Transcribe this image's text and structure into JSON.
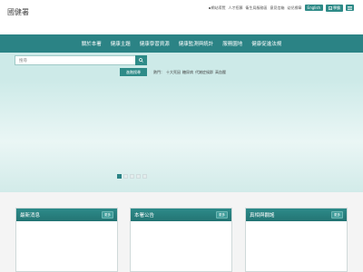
{
  "header": {
    "logo_text": "國健署",
    "top_links": [
      "網站導覽",
      "人才招募",
      "衛生局服務區",
      "意見信箱",
      "幼兒標章"
    ],
    "english_label": "English",
    "learn_label": "學霸"
  },
  "nav": {
    "items": [
      "關於本署",
      "健康主題",
      "健康學習資源",
      "健康監測與統計",
      "服務園地",
      "健康促進法規"
    ]
  },
  "search": {
    "placeholder": "搜尋",
    "advanced_label": "進階搜尋",
    "hot_label": "熱門：",
    "hot_terms": [
      "十大死因",
      "糖尿病",
      "代謝症候群",
      "高血壓"
    ]
  },
  "carousel": {
    "dot_count": 5,
    "active_index": 0
  },
  "cards": [
    {
      "title": "最新消息",
      "more_label": "更多"
    },
    {
      "title": "本署公告",
      "more_label": "更多"
    },
    {
      "title": "真相與闢謠",
      "more_label": "更多"
    }
  ],
  "colors": {
    "primary": "#2b8385",
    "search_band": "#cdeae8",
    "lower_bg": "#f4f4f4"
  }
}
